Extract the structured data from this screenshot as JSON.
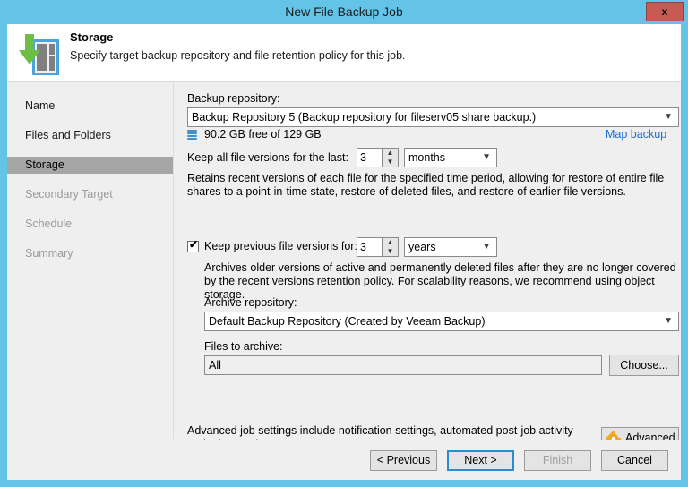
{
  "window": {
    "title": "New File Backup Job",
    "close_label": "x"
  },
  "header": {
    "title": "Storage",
    "subtitle": "Specify target backup repository and file retention policy for this job.",
    "icon": "storage-repository-icon"
  },
  "sidebar": {
    "items": [
      {
        "label": "Name",
        "state": "enabled"
      },
      {
        "label": "Files and Folders",
        "state": "enabled"
      },
      {
        "label": "Storage",
        "state": "active"
      },
      {
        "label": "Secondary Target",
        "state": "disabled"
      },
      {
        "label": "Schedule",
        "state": "disabled"
      },
      {
        "label": "Summary",
        "state": "disabled"
      }
    ]
  },
  "main": {
    "backup_repository_label": "Backup repository:",
    "backup_repository_value": "Backup Repository 5 (Backup repository for fileserv05 share backup.)",
    "repository_free_space": "90.2 GB free of 129 GB",
    "map_backup_link": "Map backup",
    "keep_all_label": "Keep all file versions for the last:",
    "keep_all_value": "3",
    "keep_all_unit": "months",
    "keep_all_description": "Retains recent versions of each file for the specified time period, allowing for restore of entire file shares to a point-in-time state, restore of deleted files, and restore of earlier file versions.",
    "keep_previous_label": "Keep previous file versions for:",
    "keep_previous_checked": true,
    "keep_previous_value": "3",
    "keep_previous_unit": "years",
    "keep_previous_description": "Archives older versions of active and permanently deleted files after they are no longer covered by the recent versions retention policy. For scalability reasons, we recommend using object storage.",
    "archive_repository_label": "Archive repository:",
    "archive_repository_value": "Default Backup Repository (Created by Veeam Backup)",
    "files_to_archive_label": "Files to archive:",
    "files_to_archive_value": "All",
    "choose_button": "Choose...",
    "advanced_description": "Advanced job settings include notification settings, automated post-job activity and other settings.",
    "advanced_button": "Advanced"
  },
  "footer": {
    "previous": "< Previous",
    "next": "Next >",
    "finish": "Finish",
    "cancel": "Cancel"
  },
  "colors": {
    "title_bar": "#63c4e8",
    "close_button": "#c75b54",
    "accent_link": "#1a6fd4",
    "active_item": "#a6a6a6",
    "gear_icon": "#f0a81e"
  }
}
